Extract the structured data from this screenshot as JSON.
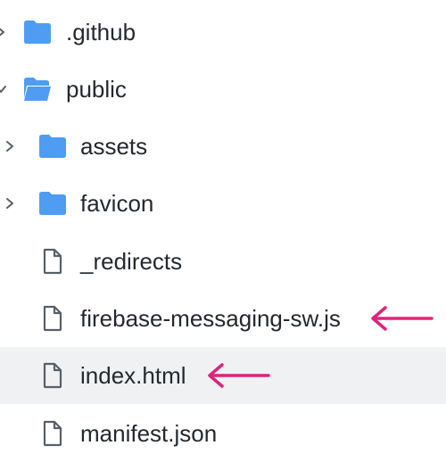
{
  "file_tree": {
    "items": [
      {
        "label": ".github",
        "type": "folder",
        "icon": "folder-icon",
        "state": "collapsed"
      },
      {
        "label": "public",
        "type": "folder",
        "icon": "folder-open-icon",
        "state": "expanded"
      },
      {
        "label": "assets",
        "type": "folder",
        "icon": "folder-icon",
        "state": "collapsed"
      },
      {
        "label": "favicon",
        "type": "folder",
        "icon": "folder-icon",
        "state": "collapsed"
      },
      {
        "label": "_redirects",
        "type": "file",
        "icon": "file-icon"
      },
      {
        "label": "firebase-messaging-sw.js",
        "type": "file",
        "icon": "file-icon",
        "annotated": true
      },
      {
        "label": "index.html",
        "type": "file",
        "icon": "file-icon",
        "annotated": true,
        "selected": true
      },
      {
        "label": "manifest.json",
        "type": "file",
        "icon": "file-icon"
      }
    ]
  },
  "colors": {
    "folder": "#4f9cf3",
    "annotation_arrow": "#e0237a",
    "selected_row_bg": "#f0f1f3",
    "text": "#24292f",
    "file_icon_stroke": "#57606a",
    "chevron": "#57606a"
  }
}
